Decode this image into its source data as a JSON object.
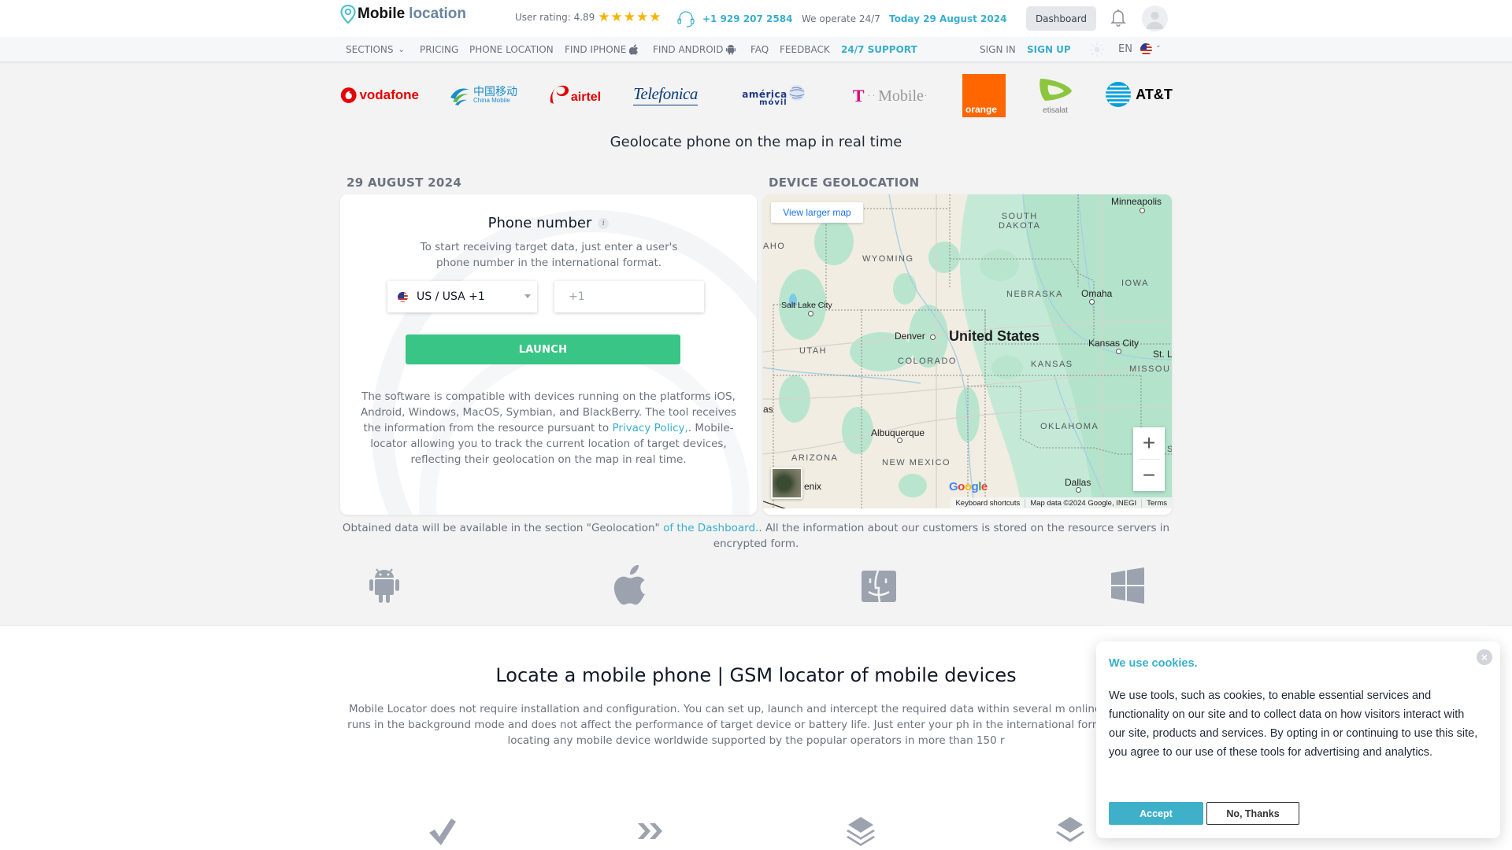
{
  "header": {
    "logo_part1": "Mobile",
    "logo_part2": "location",
    "rating_label": "User rating: 4.89",
    "rating_value": 4.89,
    "rating_stars": 5,
    "phone": "+1 929 207 2584",
    "operate": "We operate 24/7",
    "today": "Today 29 August 2024",
    "dashboard_label": "Dashboard"
  },
  "nav": {
    "items": [
      {
        "label": "SECTIONS",
        "icon": "chevron-down-icon"
      },
      {
        "label": "PRICING"
      },
      {
        "label": "PHONE LOCATION"
      },
      {
        "label": "FIND IPHONE",
        "icon": "apple-icon"
      },
      {
        "label": "FIND ANDROID",
        "icon": "android-icon"
      },
      {
        "label": "FAQ"
      },
      {
        "label": "FEEDBACK"
      },
      {
        "label": "24/7 SUPPORT",
        "accent": true
      }
    ],
    "sign_in": "SIGN IN",
    "sign_up": "SIGN UP",
    "language": "EN"
  },
  "operators": [
    "vodafone",
    "中国移动",
    "China Mobile",
    "airtel",
    "Telefonica",
    "américa",
    "móvil",
    "T",
    "Mobile",
    "orange",
    "etisalat",
    "AT&T"
  ],
  "headline": "Geolocate phone on the map in real time",
  "left_panel": {
    "date_title": "29 AUGUST 2024",
    "phone_title": "Phone number",
    "info_glyph": "i",
    "subtitle": "To start receiving target data, just enter a user's phone number in the international format.",
    "country_selected": "US / USA +1",
    "phone_placeholder": "+1",
    "launch_label": "LAUNCH",
    "compat_text_1": "The software is compatible with devices running on the platforms iOS, Android, Windows, MacOS, Symbian, and BlackBerry. The tool receives the information from the resource pursuant to ",
    "compat_link": "Privacy Policy,",
    "compat_text_2": ". Mobile-locator allowing you to track the current location of target devices, reflecting their geolocation on the map in real time."
  },
  "map_panel": {
    "title": "DEVICE GEOLOCATION",
    "view_larger": "View larger map",
    "country": "United States",
    "states": [
      "SOUTH",
      "DAKOTA",
      "WYOMING",
      "NEBRASKA",
      "IOWA",
      "UTAH",
      "COLORADO",
      "KANSAS",
      "MISSOU",
      "OKLAHOMA",
      "ARIZONA",
      "NEW MEXICO",
      "AHO",
      "as",
      "S"
    ],
    "cities": [
      "Minneapolis",
      "Omaha",
      "Salt Lake City",
      "Denver",
      "Kansas City",
      "St. L",
      "Albuquerque",
      "Dallas",
      "enix"
    ],
    "zoom_in": "+",
    "zoom_out": "−",
    "footer": [
      "Keyboard shortcuts",
      "Map data ©2024 Google, INEGI",
      "Terms"
    ],
    "google": [
      "G",
      "o",
      "o",
      "g",
      "l",
      "e"
    ]
  },
  "obtained": {
    "text_1": "Obtained data will be available in the section \"Geolocation\" ",
    "link": "of the Dashboard.",
    "text_2": ". All the information about our customers is stored on the resource servers in encrypted form."
  },
  "platforms": [
    "android-icon",
    "apple-icon",
    "finder-icon",
    "windows-icon"
  ],
  "section": {
    "title": "Locate a mobile phone | GSM locator of mobile devices",
    "text": "Mobile Locator does not require installation and configuration. You can set up, launch and intercept the required data within several m online application runs in the background mode and does not affect the performance of target device or battery life. Just enter your ph in the international format and start locating any mobile device worldwide supported by the popular operators in more than 150 r",
    "features": [
      "check-icon",
      "double-chevron-icon",
      "layers-icon",
      "layers-icon"
    ]
  },
  "cookie": {
    "title": "We use cookies.",
    "text": "We use tools, such as cookies, to enable essential services and functionality on our site and to collect data on how visitors interact with our site, products and services. By opting in or continuing to use this site, you agree to our use of these tools for advertising and analytics.",
    "accept": "Accept",
    "decline": "No, Thanks",
    "close_glyph": "×"
  },
  "colors": {
    "accent": "#3aaecb",
    "launch": "#38c585",
    "star": "#f5b400",
    "muted": "#6b7280"
  }
}
